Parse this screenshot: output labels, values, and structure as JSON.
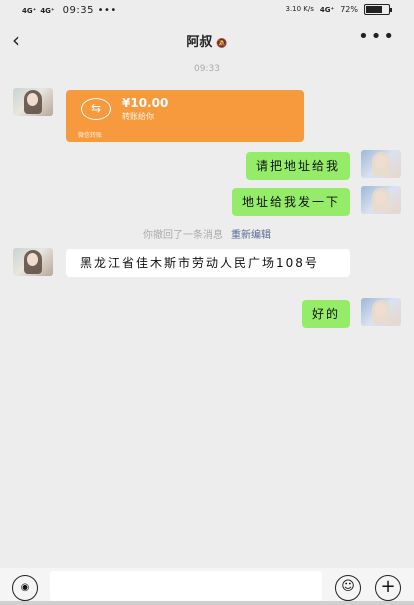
{
  "status_bar": {
    "network_1": "4G⁺",
    "network_2": "4G⁺",
    "time": "09:35 •••",
    "speed": "3.10 K/s",
    "network_3": "4G⁺",
    "battery_text": "72%",
    "battery_level": 0.72
  },
  "header": {
    "back_icon": "‹",
    "title": "阿叔",
    "mute_icon": "🔕",
    "more_icon": "•••"
  },
  "chat": {
    "timestamp": "09:33",
    "transfer": {
      "icon": "⇆",
      "amount": "¥10.00",
      "description": "转账给你",
      "footer": "微信转账"
    },
    "messages": [
      {
        "from": "me",
        "text": "请把地址给我"
      },
      {
        "from": "me",
        "text": "地址给我发一下"
      },
      {
        "from": "them",
        "text": "黑龙江省佳木斯市劳动人民广场108号"
      },
      {
        "from": "me",
        "text": "好的"
      }
    ],
    "recall_notice": "你撤回了一条消息",
    "reedit_label": "重新编辑"
  },
  "input_bar": {
    "voice_icon": "◉",
    "emoji_icon": "☺",
    "plus_icon": "+"
  }
}
